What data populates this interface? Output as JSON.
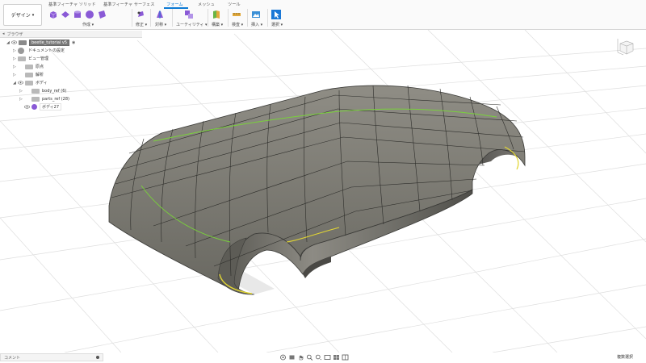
{
  "toolbar": {
    "workspace_label": "デザイン",
    "tabs": [
      "基準フィーチャ ソリッド",
      "基準フィーチャ サーフェス",
      "フォーム",
      "メッシュ",
      "ツール"
    ],
    "groups": {
      "create": "作成",
      "modify": "修正",
      "symmetry": "対称",
      "utility": "ユーティリティ",
      "modify2": "構築",
      "inspect": "検査",
      "insert": "挿入",
      "select": "選択"
    }
  },
  "browser": {
    "title": "ブラウザ",
    "items": [
      {
        "label": "beetle_tutorial v5",
        "type": "root"
      },
      {
        "label": "ドキュメントの設定",
        "type": "settings"
      },
      {
        "label": "ビュー管理",
        "type": "folder"
      },
      {
        "label": "原点",
        "type": "folder"
      },
      {
        "label": "解析",
        "type": "folder"
      },
      {
        "label": "ボディ",
        "type": "folder"
      },
      {
        "label": "body_ref (6)",
        "type": "folder"
      },
      {
        "label": "parts_ref (28)",
        "type": "folder"
      },
      {
        "label": "ボディ27",
        "type": "body"
      }
    ]
  },
  "bottom": {
    "comments_label": "コメント",
    "status_text": "複数選択"
  },
  "colors": {
    "accent": "#0d7ad4",
    "form_tool": "#8a5ad6",
    "body_surface": "#6e6d66",
    "edge_highlight": "#e2d633",
    "curve_highlight": "#79d23a"
  }
}
